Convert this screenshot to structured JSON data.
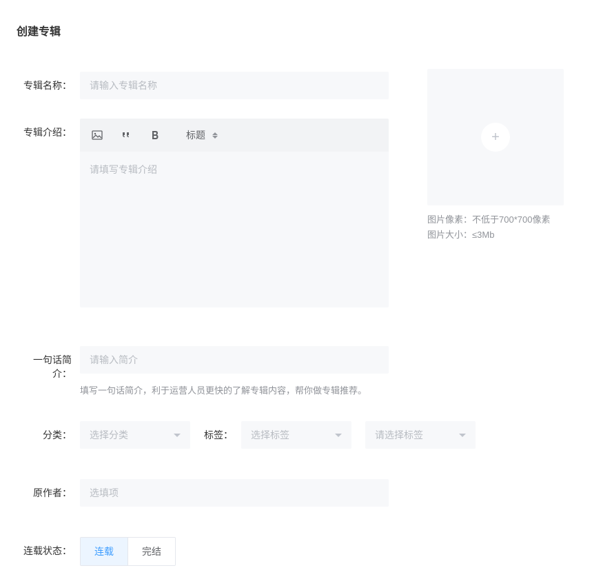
{
  "page": {
    "title": "创建专辑"
  },
  "form": {
    "album_name": {
      "label": "专辑名称：",
      "placeholder": "请输入专辑名称",
      "value": ""
    },
    "album_intro": {
      "label": "专辑介绍：",
      "placeholder": "请填写专辑介绍",
      "toolbar": {
        "heading_label": "标题"
      }
    },
    "brief": {
      "label": "一句话简介：",
      "placeholder": "请输入简介",
      "value": "",
      "help_text": "填写一句话简介，利于运营人员更快的了解专辑内容，帮你做专辑推荐。"
    },
    "category": {
      "label": "分类：",
      "placeholder": "选择分类"
    },
    "tags": {
      "label": "标签：",
      "placeholder1": "选择标签",
      "placeholder2": "请选择标签"
    },
    "original_author": {
      "label": "原作者：",
      "placeholder": "选填项",
      "value": ""
    },
    "serial_status": {
      "label": "连载状态：",
      "options": [
        {
          "label": "连载",
          "value": "serializing",
          "active": true
        },
        {
          "label": "完结",
          "value": "completed",
          "active": false
        }
      ]
    }
  },
  "image_upload": {
    "pixel_label": "图片像素：",
    "pixel_value": "不低于700*700像素",
    "size_label": "图片大小：",
    "size_value": "≤3Mb"
  }
}
